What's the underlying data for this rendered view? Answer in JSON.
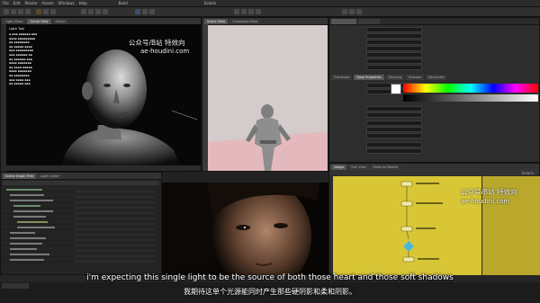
{
  "app": {
    "menu": [
      "File",
      "Edit",
      "Render",
      "Assets",
      "Windows",
      "Help",
      "Build",
      "Solaris"
    ]
  },
  "viewport_left": {
    "tabs": [
      "Light Mixer",
      "Scene View",
      "Object"
    ],
    "overlay_title": "Light Tool",
    "watermark": "公众号/B站 特效向",
    "watermark_url": "ae-houdini.com"
  },
  "viewport_mid": {
    "tabs": [
      "Scene View",
      "Composite View"
    ]
  },
  "properties": {
    "tabs": [
      "Transform",
      "Base Properties",
      "Shaping",
      "Shadow",
      "Advanced"
    ]
  },
  "scene_graph": {
    "tabs": [
      "Scene Graph Tree",
      "Light Linker"
    ]
  },
  "network": {
    "tabs": [
      "/stage",
      "Tree View",
      "Material Palette"
    ],
    "brand": "Solaris",
    "watermark": "公众号/B站 特效向",
    "watermark_url": "ae-houdini.com"
  },
  "subtitles": {
    "english": "i'm expecting this single light to be the source of both those heart and those soft shadows",
    "chinese": "我期待这单个光源能同时产生那些硬阴影和柔和阴影。"
  },
  "colors": {
    "accent_yellow": "#d8c636",
    "node_yellow": "#b9a82b"
  }
}
